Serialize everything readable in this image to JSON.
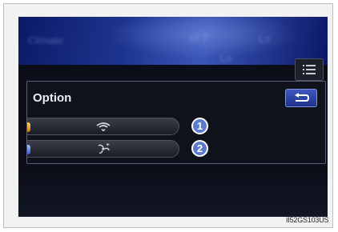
{
  "screen": {
    "background_title": "Climate",
    "background_temp": "68 F",
    "background_item": "Lo",
    "background_center": "Lo"
  },
  "option_panel": {
    "title": "Option",
    "return_icon": "return-arrow-icon",
    "buttons": [
      {
        "icon": "air-intake-icon",
        "indicator_color": "#f0a024",
        "callout": "1"
      },
      {
        "icon": "fan-defog-icon",
        "indicator_color": "#4f7ae6",
        "callout": "2"
      }
    ]
  },
  "menu_icon": "list-menu-icon",
  "image_code": "II52GS103US"
}
